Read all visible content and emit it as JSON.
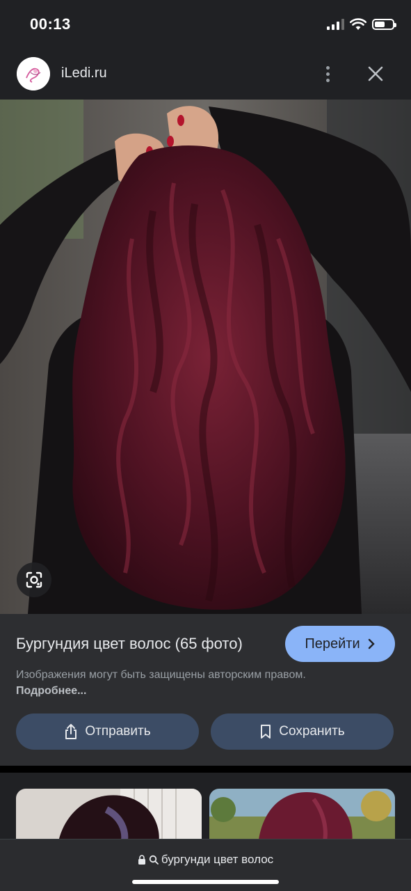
{
  "status_bar": {
    "time": "00:13",
    "battery_level": 0.6
  },
  "header": {
    "site_name": "iLedi.ru"
  },
  "image_info": {
    "title": "Бургундия цвет волос (65 фото)",
    "visit_label": "Перейти",
    "copyright_text": "Изображения могут быть защищены авторским правом.",
    "more_link": "Подробнее...",
    "share_label": "Отправить",
    "save_label": "Сохранить"
  },
  "browser": {
    "url_text": "бургунди цвет волос"
  },
  "colors": {
    "accent": "#8ab4f8",
    "action_button": "#3c4c65",
    "hair": "#5a1424"
  },
  "icons": [
    "lens-icon",
    "more-vert-icon",
    "close-icon",
    "share-icon",
    "bookmark-icon",
    "lock-icon",
    "search-icon",
    "chevron-right-icon"
  ]
}
